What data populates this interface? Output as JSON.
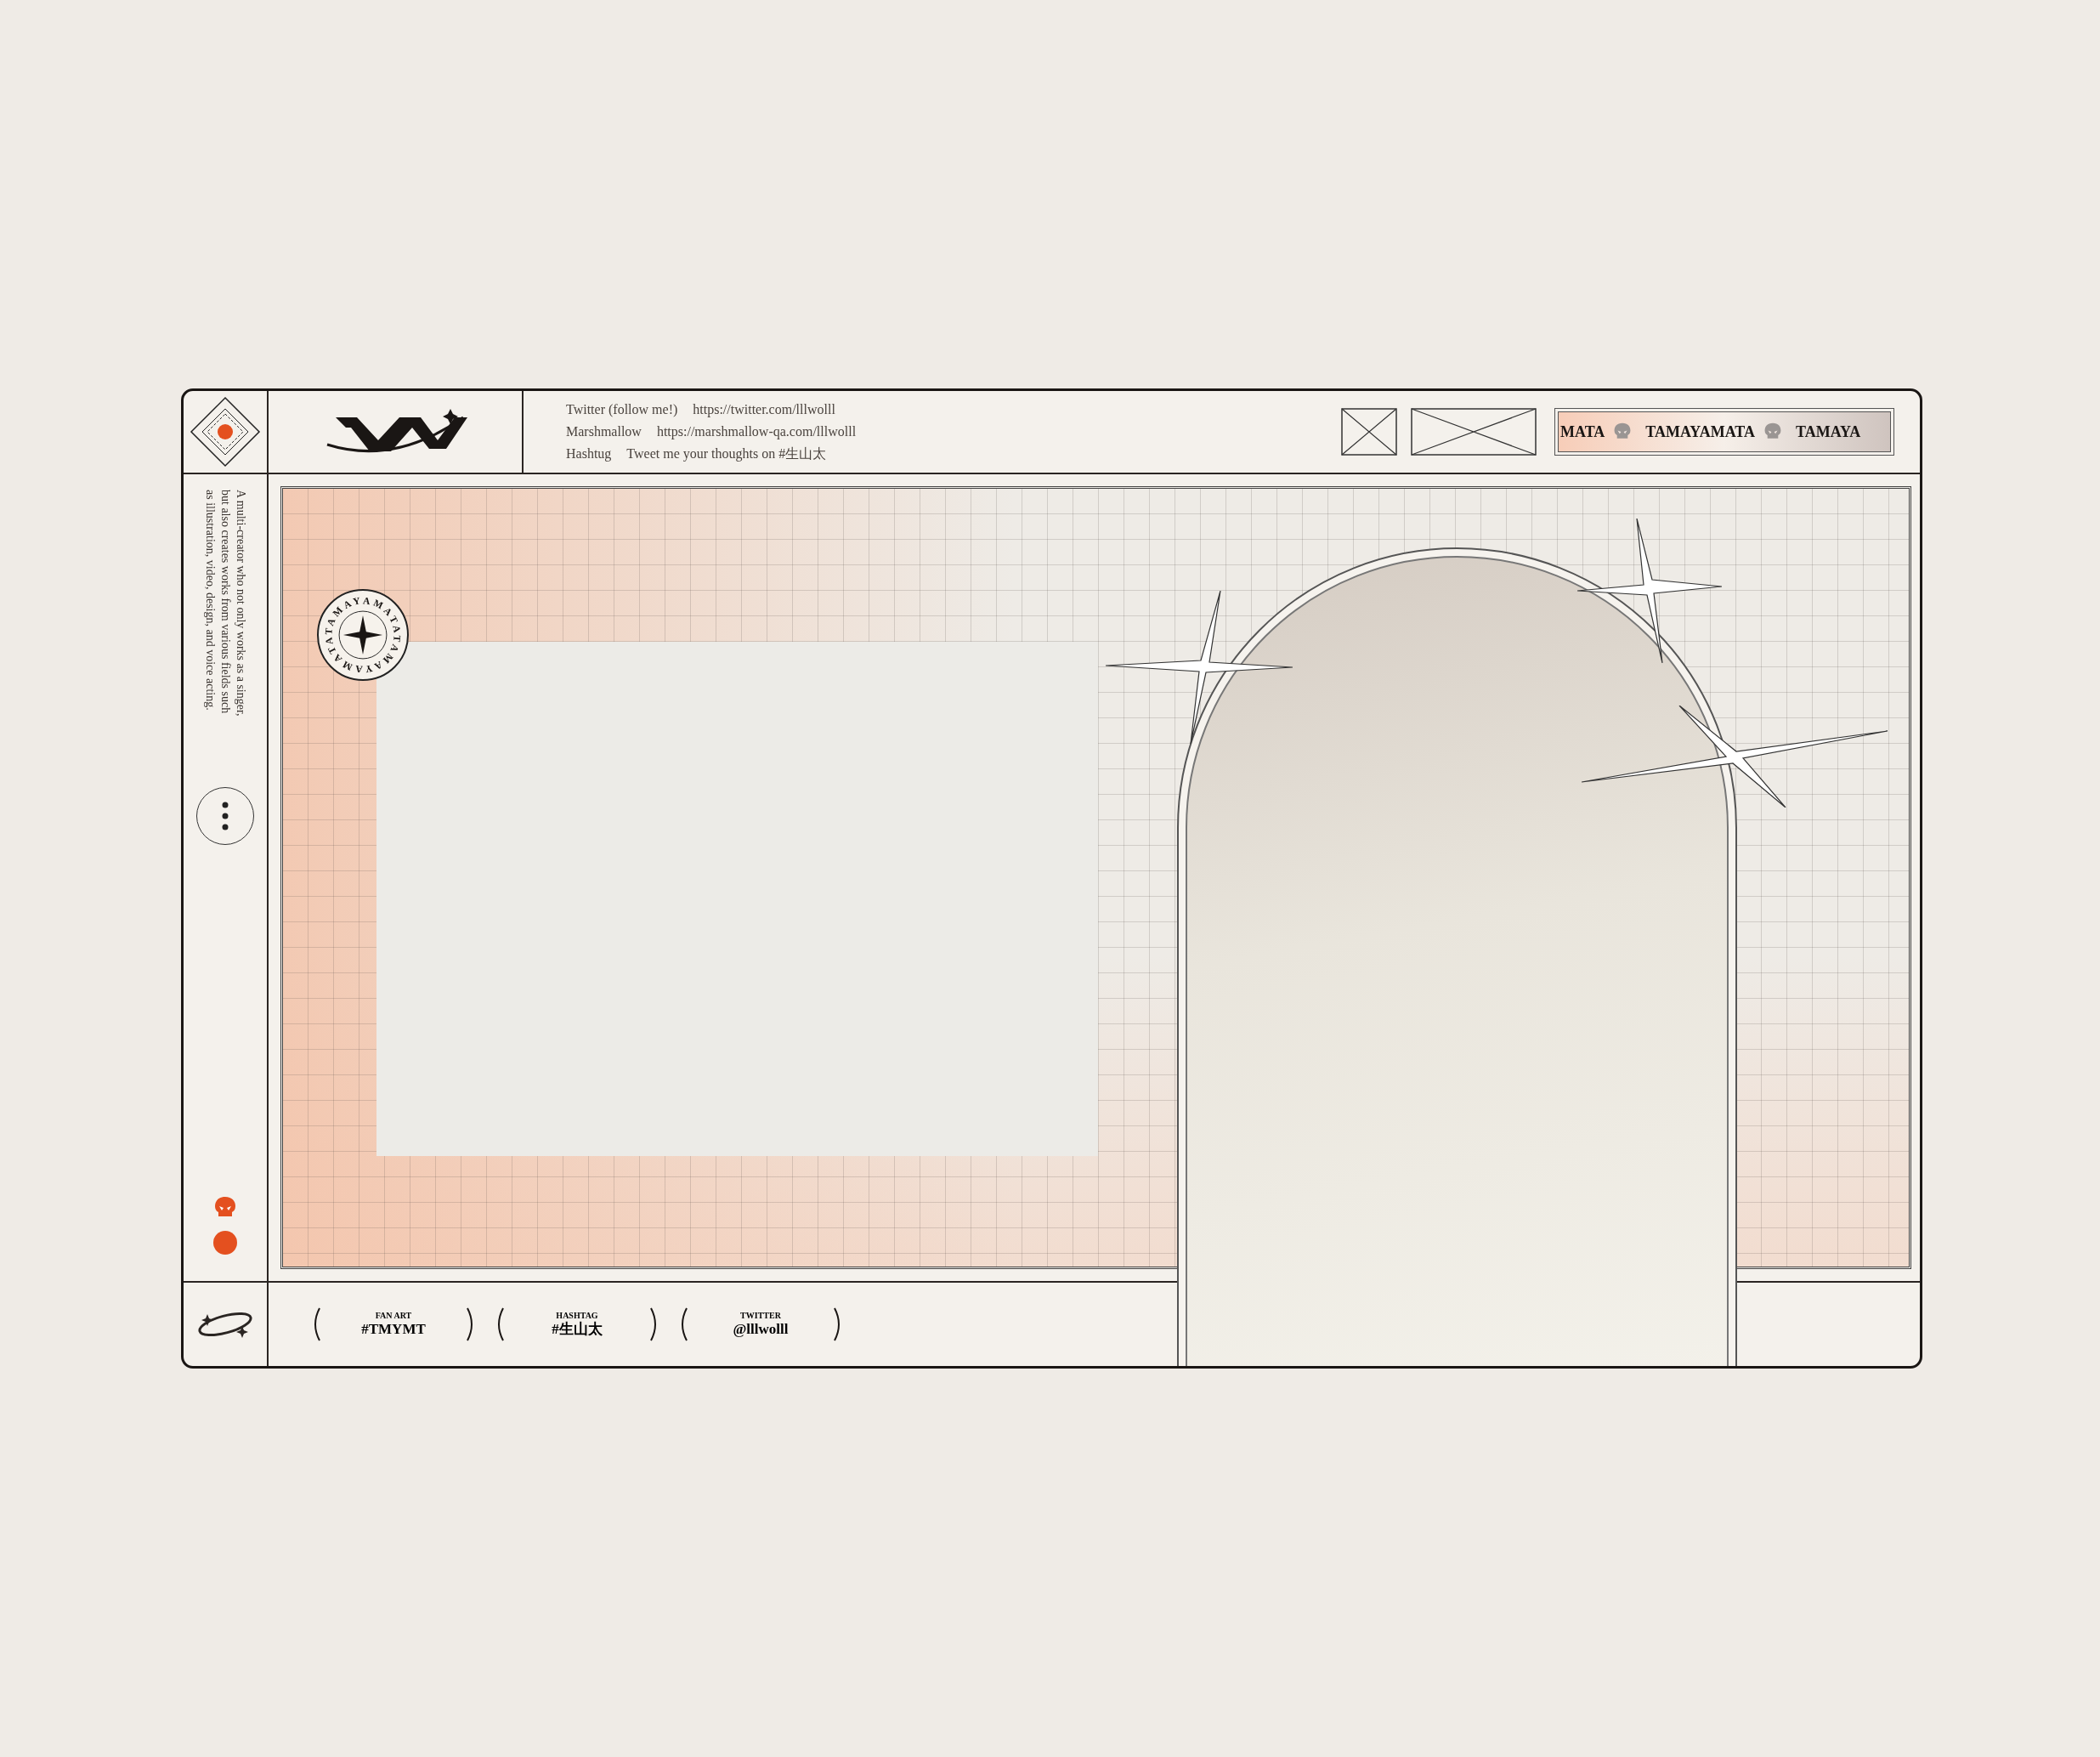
{
  "header": {
    "links": [
      {
        "label": "Twitter (follow me!)",
        "value": "https://twitter.com/lllwolll"
      },
      {
        "label": "Marshmallow",
        "value": "https://marshmallow-qa.com/lllwolll"
      },
      {
        "label": "Hashtug",
        "value": "Tweet me your thoughts on #生山太"
      }
    ],
    "marquee": [
      "MATA",
      "TAMAYAMATA",
      "TAMAYA"
    ]
  },
  "sidebar": {
    "bio": "A multi-creator who not only works as a singer, but also creates works from various fields such as illustration, video, design, and voice acting."
  },
  "badge": {
    "text": "TAMAYAMATATAMAYAMATA"
  },
  "footer": {
    "tags": [
      {
        "label": "FAN ART",
        "value": "#TMYMT"
      },
      {
        "label": "HASHTAG",
        "value": "#生山太"
      },
      {
        "label": "TWITTER",
        "value": "@lllwolll"
      }
    ]
  }
}
